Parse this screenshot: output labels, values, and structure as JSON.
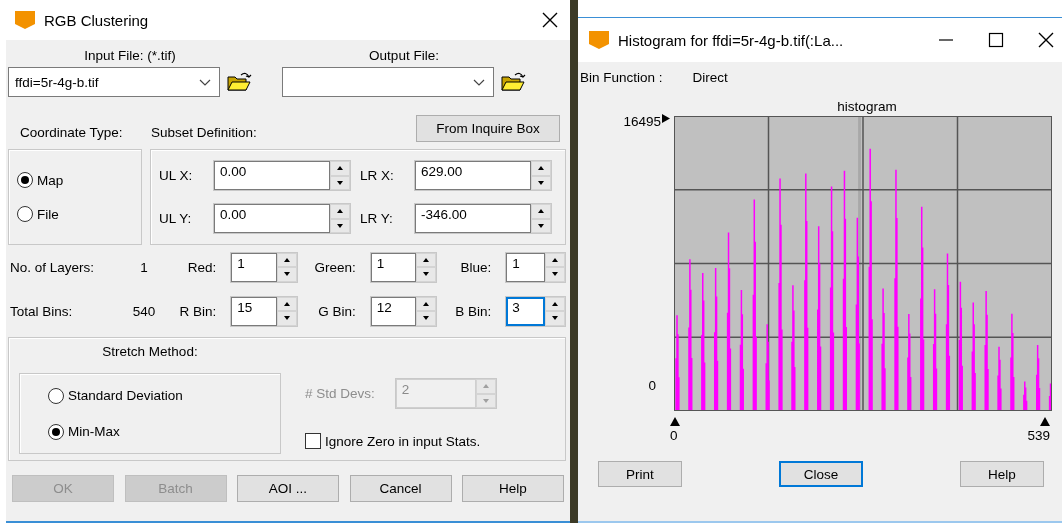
{
  "dialog": {
    "title": "RGB Clustering",
    "input_file": {
      "label": "Input File: (*.tif)",
      "value": "ffdi=5r-4g-b.tif"
    },
    "output_file": {
      "label": "Output File:"
    },
    "coordinate_type": {
      "label": "Coordinate Type:",
      "options": [
        {
          "label": "Map",
          "selected": true
        },
        {
          "label": "File",
          "selected": false
        }
      ]
    },
    "subset": {
      "label": "Subset Definition:",
      "button": "From Inquire Box",
      "fields": [
        {
          "label": "UL X:",
          "value": "0.00",
          "focused": false
        },
        {
          "label": "LR X:",
          "value": "629.00",
          "focused": false
        },
        {
          "label": "UL Y:",
          "value": "0.00",
          "focused": false
        },
        {
          "label": "LR Y:",
          "value": "-346.00",
          "focused": false
        }
      ]
    },
    "layers": {
      "label": "No. of Layers:",
      "value": "1",
      "fields": [
        {
          "label": "Red:",
          "value": "1",
          "focused": false
        },
        {
          "label": "Green:",
          "value": "1",
          "focused": false
        },
        {
          "label": "Blue:",
          "value": "1",
          "focused": false
        }
      ]
    },
    "bins": {
      "label": "Total Bins:",
      "value": "540",
      "fields": [
        {
          "label": "R Bin:",
          "value": "15",
          "focused": false
        },
        {
          "label": "G Bin:",
          "value": "12",
          "focused": false
        },
        {
          "label": "B Bin:",
          "value": "3",
          "focused": true
        }
      ]
    },
    "stretch": {
      "label": "Stretch Method:",
      "options": [
        {
          "label": "Standard Deviation",
          "selected": false
        },
        {
          "label": "Min-Max",
          "selected": true
        }
      ],
      "std_devs": {
        "label": "# Std Devs:",
        "value": "2",
        "disabled": true
      },
      "ignore_zero": {
        "label": "Ignore Zero in input Stats.",
        "checked": false
      }
    },
    "buttons": [
      {
        "label": "OK",
        "disabled": true
      },
      {
        "label": "Batch",
        "disabled": true
      },
      {
        "label": "AOI ...",
        "disabled": false
      },
      {
        "label": "Cancel",
        "disabled": false
      },
      {
        "label": "Help",
        "disabled": false
      }
    ]
  },
  "histogram_window": {
    "title": "Histogram for ffdi=5r-4g-b.tif(:La...",
    "bin_function_label": "Bin Function :",
    "bin_function": "Direct",
    "plot_title": "histogram",
    "y_max": "16495",
    "y_min": "0",
    "x_min": "0",
    "x_max": "539",
    "buttons": [
      {
        "label": "Print",
        "default": false
      },
      {
        "label": "Close",
        "default": true
      },
      {
        "label": "Help",
        "default": false
      }
    ]
  }
}
